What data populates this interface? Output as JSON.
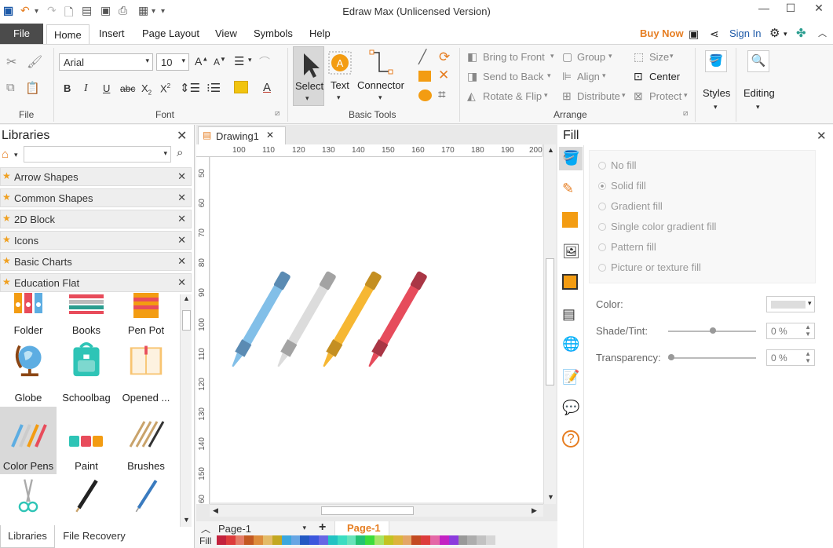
{
  "window": {
    "title": "Edraw Max (Unlicensed Version)"
  },
  "menu": {
    "file": "File",
    "tabs": [
      "Home",
      "Insert",
      "Page Layout",
      "View",
      "Symbols",
      "Help"
    ],
    "buy_now": "Buy Now",
    "sign_in": "Sign In"
  },
  "ribbon": {
    "font_name": "Arial",
    "font_size": "10",
    "groups": {
      "file": "File",
      "font": "Font",
      "basic_tools": "Basic Tools",
      "arrange": "Arrange"
    },
    "tools": {
      "select": "Select",
      "text": "Text",
      "connector": "Connector"
    },
    "arrange": {
      "bring_to_front": "Bring to Front",
      "send_to_back": "Send to Back",
      "rotate_flip": "Rotate & Flip",
      "group": "Group",
      "align": "Align",
      "distribute": "Distribute",
      "size": "Size",
      "center": "Center",
      "protect": "Protect"
    },
    "styles": "Styles",
    "editing": "Editing"
  },
  "libraries": {
    "title": "Libraries",
    "search_placeholder": "",
    "categories": [
      "Arrow Shapes",
      "Common Shapes",
      "2D Block",
      "Icons",
      "Basic Charts",
      "Education Flat"
    ],
    "shapes": [
      "Folder",
      "Books",
      "Pen Pot",
      "Globe",
      "Schoolbag",
      "Opened ...",
      "Color Pens",
      "Paint",
      "Brushes"
    ],
    "bottom_tabs": {
      "libraries": "Libraries",
      "file_recovery": "File Recovery"
    }
  },
  "document": {
    "tab": "Drawing1",
    "ruler_h": [
      "100",
      "110",
      "120",
      "130",
      "140",
      "150",
      "160",
      "170",
      "180",
      "190",
      "200"
    ],
    "ruler_v": [
      "50",
      "60",
      "70",
      "80",
      "90",
      "100",
      "110",
      "120",
      "130",
      "140",
      "150",
      "60"
    ],
    "page_select": "Page-1",
    "active_page": "Page-1",
    "fill_label": "Fill"
  },
  "pens": [
    {
      "body": "#82bfe8",
      "cap": "#5b8bb3"
    },
    {
      "body": "#dcdcdc",
      "cap": "#a3a3a3"
    },
    {
      "body": "#f6b733",
      "cap": "#c48f22"
    },
    {
      "body": "#e64c5c",
      "cap": "#a93645"
    }
  ],
  "fill_panel": {
    "title": "Fill",
    "options": [
      "No fill",
      "Solid fill",
      "Gradient fill",
      "Single color gradient fill",
      "Pattern fill",
      "Picture or texture fill"
    ],
    "selected": "Solid fill",
    "color_label": "Color:",
    "shade_label": "Shade/Tint:",
    "shade_value": "0 %",
    "transparency_label": "Transparency:",
    "transparency_value": "0 %"
  },
  "colors": {
    "accent": "#e67e22",
    "file_bg": "#4b4b4b"
  }
}
